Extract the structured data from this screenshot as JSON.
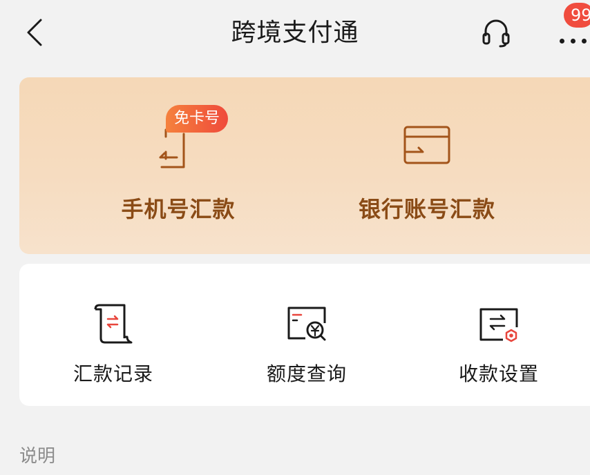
{
  "header": {
    "title": "跨境支付通",
    "back_icon": "chevron-left-icon",
    "service_icon": "headset-icon",
    "more_icon": "more-dots-icon",
    "badge_count": "99"
  },
  "hero": {
    "items": [
      {
        "label": "手机号汇款",
        "tag": "免卡号",
        "icon": "phone-transfer-icon"
      },
      {
        "label": "银行账号汇款",
        "icon": "bank-card-transfer-icon"
      }
    ],
    "colors": {
      "label": "#8a4b16",
      "icon_stroke": "#a3541a",
      "tag_start": "#f5813d",
      "tag_end": "#ef4a3b"
    }
  },
  "tools": [
    {
      "label": "汇款记录",
      "icon": "scroll-record-icon"
    },
    {
      "label": "额度查询",
      "icon": "quota-search-icon"
    },
    {
      "label": "收款设置",
      "icon": "receive-settings-icon"
    }
  ],
  "accent_color": "#e8453c",
  "section": {
    "label": "说明"
  }
}
